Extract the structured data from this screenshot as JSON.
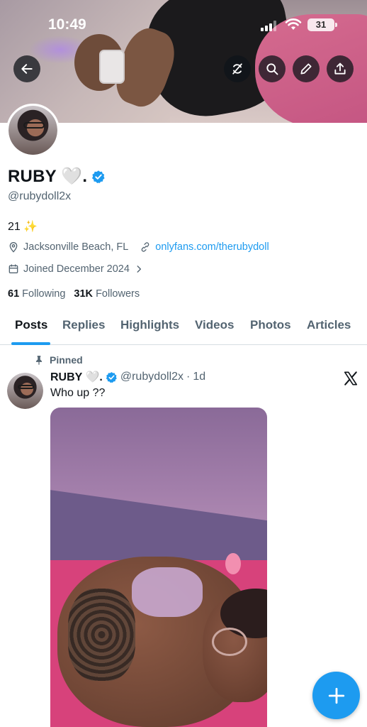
{
  "status_bar": {
    "time": "10:49",
    "battery": "31"
  },
  "profile": {
    "display_name": "RUBY 🤍.",
    "handle": "@rubydoll2x",
    "bio": "21 ✨",
    "location": "Jacksonville Beach, FL",
    "website": "onlyfans.com/therubydoll",
    "joined": "Joined December 2024",
    "following_count": "61",
    "following_label": "Following",
    "followers_count": "31K",
    "followers_label": "Followers"
  },
  "tabs": [
    {
      "label": "Posts",
      "active": true
    },
    {
      "label": "Replies"
    },
    {
      "label": "Highlights"
    },
    {
      "label": "Videos"
    },
    {
      "label": "Photos"
    },
    {
      "label": "Articles"
    }
  ],
  "post": {
    "pinned_label": "Pinned",
    "author_name": "RUBY 🤍.",
    "author_handle": "@rubydoll2x",
    "separator": "·",
    "time": "1d",
    "text": "Who up ??"
  },
  "icons": {
    "back": "arrow-left-icon",
    "no_retweets": "slashed-repost-icon",
    "search": "search-icon",
    "edit": "pencil-icon",
    "share": "share-icon",
    "verified": "verified-badge-icon",
    "location": "location-pin-icon",
    "link": "link-icon",
    "calendar": "calendar-icon",
    "pin": "pin-icon",
    "x_logo": "x-logo-icon",
    "compose": "plus-icon"
  },
  "colors": {
    "accent": "#1d9bf0",
    "text": "#0f1419",
    "secondary": "#536471"
  }
}
